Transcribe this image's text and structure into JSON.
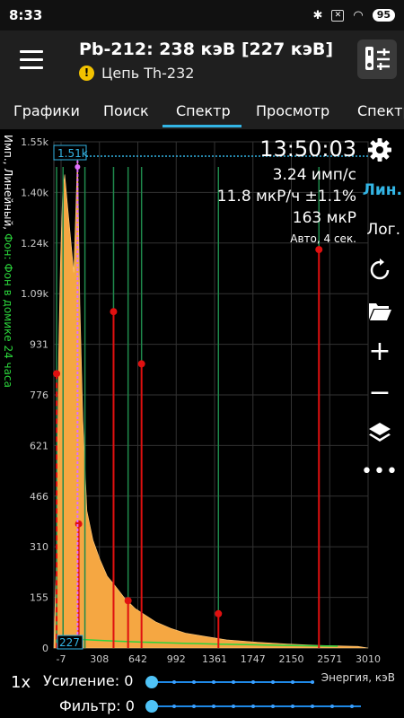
{
  "status": {
    "time": "8:33",
    "battery": "95"
  },
  "appbar": {
    "title": "Pb-212: 238 кэВ [227 кэВ]",
    "subtitle": "Цепь Th-232",
    "warn_glyph": "!"
  },
  "tabs": [
    "Графики",
    "Поиск",
    "Спектр",
    "Просмотр",
    "Спектр"
  ],
  "active_tab": "Спектр",
  "plot": {
    "ylabel_main": "Имп., Линейный,",
    "ylabel_bg": "Фон: Фон в домике 24 часа",
    "cursor_count_label": "1.51k",
    "cursor_channel_label": "227",
    "time": "13:50:03",
    "rate": "3.24 имп/с",
    "dose_rate": "11.8 мкР/ч ±1.1%",
    "dose": "163 мкР",
    "mode": "Авто, 4 сек.",
    "scale_lin": "Лин.",
    "scale_log": "Лог.",
    "xaxis_title": "Энергия, кэВ"
  },
  "chart_data": {
    "type": "area",
    "y_ticks": [
      "0",
      "155",
      "310",
      "466",
      "621",
      "776",
      "931",
      "1.09k",
      "1.24k",
      "1.40k",
      "1.55k"
    ],
    "x_ticks": [
      "-7",
      "308",
      "642",
      "992",
      "1361",
      "1747",
      "2150",
      "2571",
      "3010"
    ],
    "ylim": [
      0,
      1550
    ],
    "xlim": [
      -7,
      3100
    ],
    "spectrum_shape": [
      [
        -7,
        0
      ],
      [
        20,
        300
      ],
      [
        40,
        900
      ],
      [
        60,
        1200
      ],
      [
        80,
        1400
      ],
      [
        100,
        1450
      ],
      [
        130,
        1350
      ],
      [
        160,
        1250
      ],
      [
        190,
        1150
      ],
      [
        227,
        1510
      ],
      [
        250,
        1050
      ],
      [
        280,
        700
      ],
      [
        320,
        420
      ],
      [
        380,
        330
      ],
      [
        450,
        270
      ],
      [
        520,
        220
      ],
      [
        600,
        190
      ],
      [
        700,
        150
      ],
      [
        800,
        120
      ],
      [
        900,
        100
      ],
      [
        1000,
        80
      ],
      [
        1150,
        60
      ],
      [
        1300,
        45
      ],
      [
        1500,
        35
      ],
      [
        1700,
        25
      ],
      [
        2000,
        18
      ],
      [
        2300,
        12
      ],
      [
        2600,
        8
      ],
      [
        3000,
        5
      ],
      [
        3100,
        0
      ]
    ],
    "markers": [
      {
        "energy": 20,
        "count": 840,
        "style": "dashed"
      },
      {
        "energy": 238,
        "count": 380,
        "style": "solid"
      },
      {
        "energy": 583,
        "count": 1030,
        "style": "solid"
      },
      {
        "energy": 727,
        "count": 145,
        "style": "solid"
      },
      {
        "energy": 860,
        "count": 870,
        "style": "solid"
      },
      {
        "energy": 1620,
        "count": 105,
        "style": "solid"
      },
      {
        "energy": 2614,
        "count": 1220,
        "style": "solid"
      }
    ],
    "green_lines": [
      20,
      84,
      300,
      583,
      727,
      860,
      1620,
      2614
    ],
    "cursor_energy": 227
  },
  "bottom": {
    "gain_mult": "1x",
    "gain_label": "Усиление: 0",
    "filter_label": "Фильтр: 0"
  },
  "colors": {
    "accent": "#33b5e5",
    "spectrum": "#f5a742",
    "marker": "#e01010",
    "background_line": "#2bd43b",
    "cursor": "#e070ff"
  }
}
